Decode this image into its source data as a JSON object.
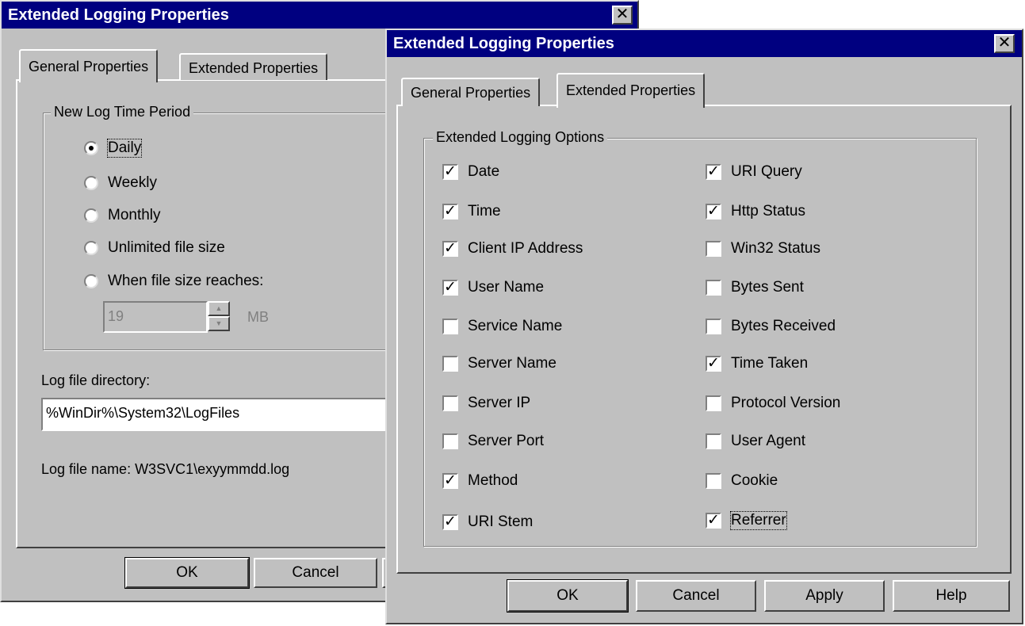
{
  "back_dialog": {
    "title": "Extended Logging Properties",
    "close_glyph": "✕",
    "tabs": [
      "General Properties",
      "Extended Properties"
    ],
    "active_tab": "General Properties",
    "group_caption": "New Log Time Period",
    "radios": [
      {
        "label": "Daily",
        "checked": true
      },
      {
        "label": "Weekly",
        "checked": false
      },
      {
        "label": "Monthly",
        "checked": false
      },
      {
        "label": "Unlimited file size",
        "checked": false
      },
      {
        "label": "When file size reaches:",
        "checked": false
      }
    ],
    "size_value": "19",
    "size_unit": "MB",
    "dir_label": "Log file directory:",
    "dir_value": "%WinDir%\\System32\\LogFiles",
    "file_name_text": "Log file name: W3SVC1\\exyymmdd.log",
    "buttons": {
      "ok": "OK",
      "cancel": "Cancel"
    }
  },
  "front_dialog": {
    "title": "Extended Logging Properties",
    "close_glyph": "✕",
    "tabs": [
      "General Properties",
      "Extended Properties"
    ],
    "active_tab": "Extended Properties",
    "group_caption": "Extended Logging Options",
    "left_options": [
      {
        "label": "Date",
        "checked": true
      },
      {
        "label": "Time",
        "checked": true
      },
      {
        "label": "Client IP Address",
        "checked": true
      },
      {
        "label": "User Name",
        "checked": true
      },
      {
        "label": "Service Name",
        "checked": false
      },
      {
        "label": "Server Name",
        "checked": false
      },
      {
        "label": "Server IP",
        "checked": false
      },
      {
        "label": "Server Port",
        "checked": false
      },
      {
        "label": "Method",
        "checked": true
      },
      {
        "label": "URI Stem",
        "checked": true
      }
    ],
    "right_options": [
      {
        "label": "URI Query",
        "checked": true
      },
      {
        "label": "Http Status",
        "checked": true
      },
      {
        "label": "Win32 Status",
        "checked": false
      },
      {
        "label": "Bytes Sent",
        "checked": false
      },
      {
        "label": "Bytes Received",
        "checked": false
      },
      {
        "label": "Time Taken",
        "checked": true
      },
      {
        "label": "Protocol Version",
        "checked": false
      },
      {
        "label": "User Agent",
        "checked": false
      },
      {
        "label": "Cookie",
        "checked": false
      },
      {
        "label": "Referrer",
        "checked": true
      }
    ],
    "buttons": {
      "ok": "OK",
      "cancel": "Cancel",
      "apply": "Apply",
      "help": "Help"
    }
  }
}
